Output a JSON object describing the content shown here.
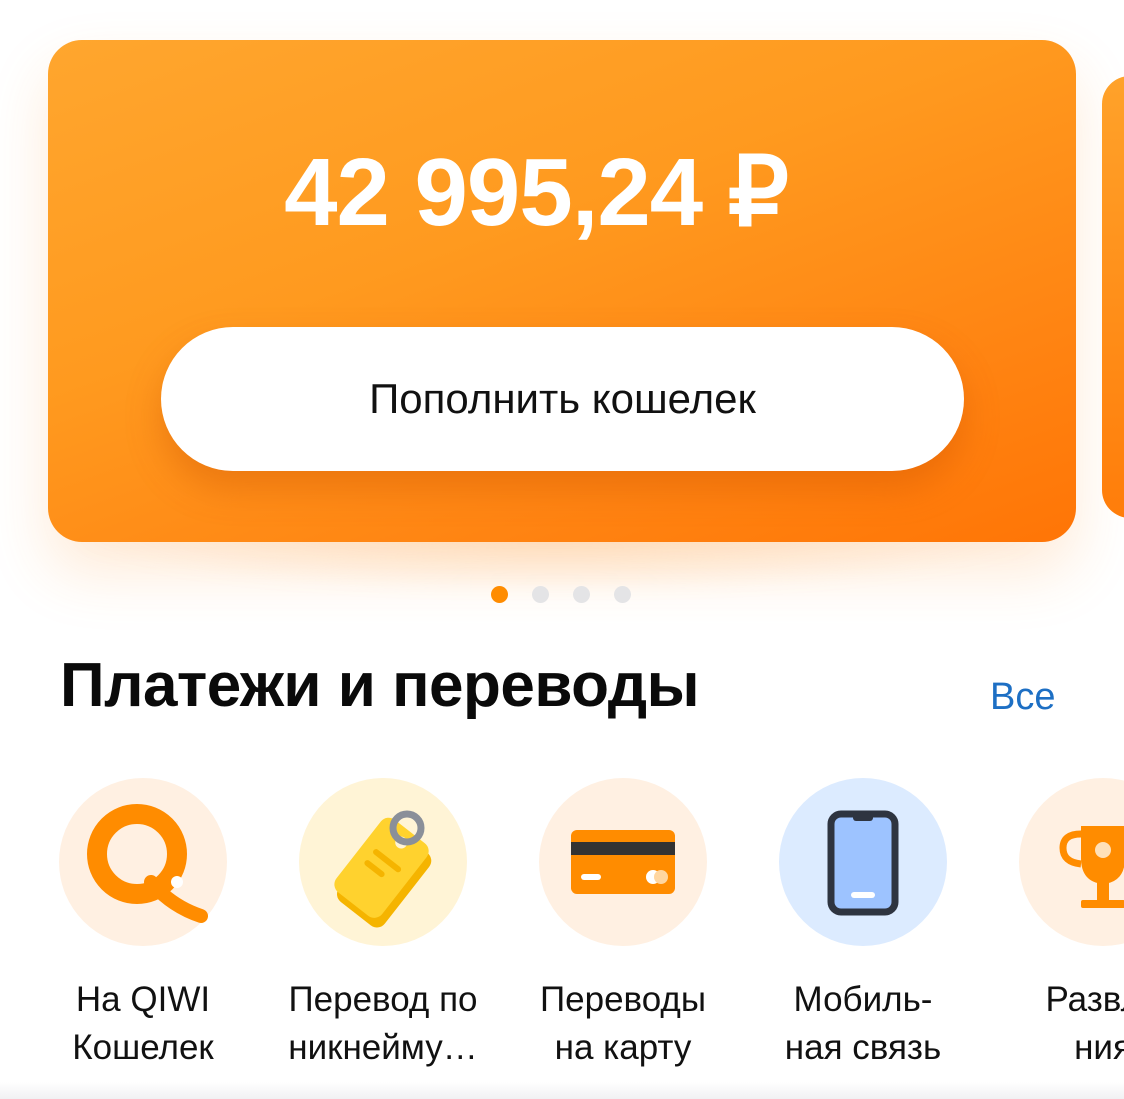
{
  "wallet": {
    "balance": "42 995,24 ₽",
    "topup_label": "Пополнить кошелек",
    "pager": {
      "count": 4,
      "active": 0
    }
  },
  "payments": {
    "title": "Платежи и переводы",
    "all_label": "Все",
    "items": [
      {
        "icon": "qiwi-logo-icon",
        "line1": "На QIWI",
        "line2": "Кошелек",
        "bg": "#fff0e2"
      },
      {
        "icon": "price-tag-icon",
        "line1": "Перевод по",
        "line2": "никнейму…",
        "bg": "#fff4d6"
      },
      {
        "icon": "bank-card-icon",
        "line1": "Переводы",
        "line2": "на карту",
        "bg": "#fff0e2"
      },
      {
        "icon": "mobile-phone-icon",
        "line1": "Мобиль-",
        "line2": "ная связь",
        "bg": "#dcebff"
      },
      {
        "icon": "trophy-icon",
        "line1": "Развле",
        "line2": "ния",
        "bg": "#fff0e2"
      }
    ]
  },
  "colors": {
    "accent_orange": "#ff8c00",
    "link_blue": "#1d6fc4"
  }
}
